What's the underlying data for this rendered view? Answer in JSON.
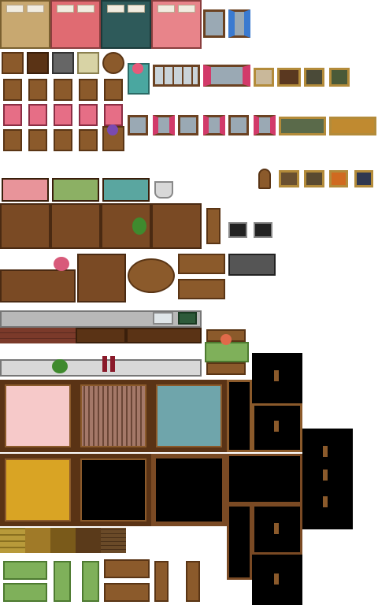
{
  "tileset": {
    "background_color": "#ffffff",
    "accent_wood": "#7a4a24",
    "accent_pink": "#e06b72",
    "accent_teal": "#2e5a5a"
  }
}
